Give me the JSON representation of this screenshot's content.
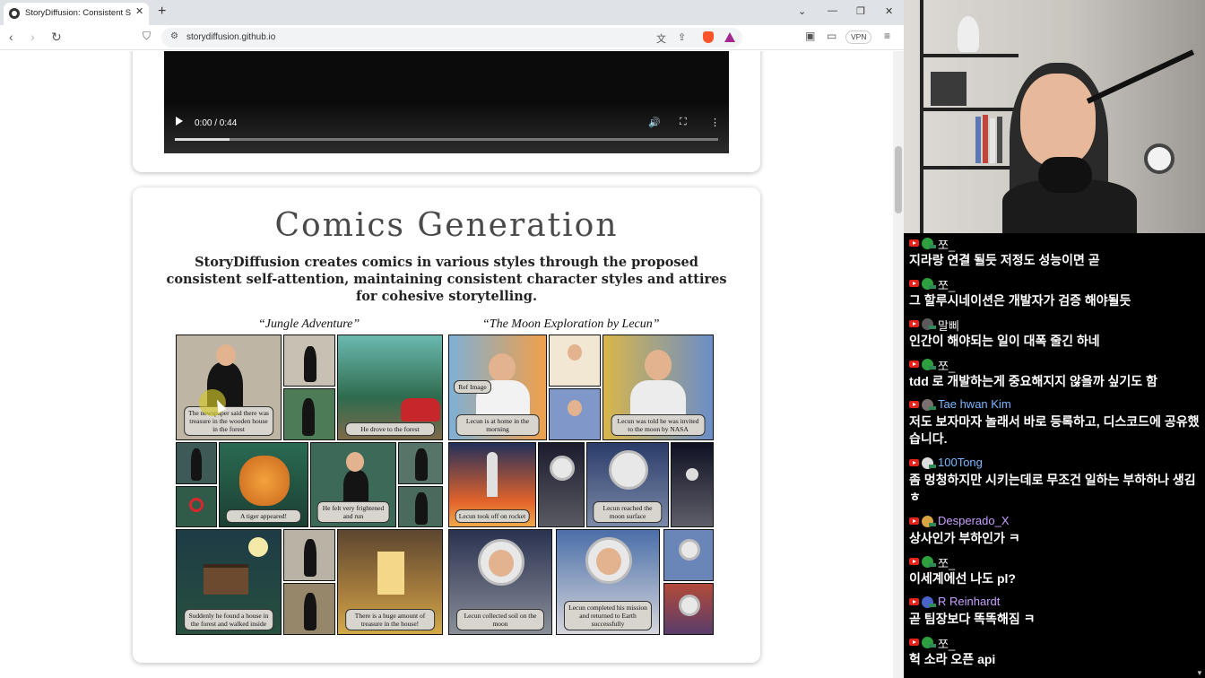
{
  "browser": {
    "tab_title": "StoryDiffusion: Consistent Self-",
    "url": "storydiffusion.github.io",
    "vpn_label": "VPN",
    "icons": [
      "globe-icon",
      "close-icon",
      "plus-icon",
      "chevron-down-icon",
      "minimize-icon",
      "restore-icon",
      "back-icon",
      "forward-icon",
      "reload-icon",
      "bookmark-icon",
      "translate-icon",
      "share-icon",
      "brave-shield-icon",
      "brave-rewards-icon",
      "sidebar-icon",
      "wallet-icon",
      "menu-icon"
    ]
  },
  "video": {
    "time": "0:00 / 0:44",
    "buffered_fraction": 0.1
  },
  "comics": {
    "title": "Comics Generation",
    "description": "StoryDiffusion creates comics in various styles through the proposed consistent self-attention, maintaining consistent character styles and attires for cohesive storytelling.",
    "strip1": {
      "title": "“Jungle Adventure”",
      "captions": [
        "The newspaper said there was treasure in the wooden house in the forest",
        "He drove to the forest",
        "A tiger appeared!",
        "He felt very frightened and run",
        "Suddenly he found a house in the forest and walked inside",
        "There is a huge amount of treasure in the house!"
      ]
    },
    "strip2": {
      "title": "“The Moon Exploration by Lecun”",
      "captions": [
        "Ref Image",
        "Lecun is at home in the morning",
        "Lecun was told he was invited to the moon by NASA",
        "Lecun took off on rocket",
        "Lecun reached the moon surface",
        "Lecun collected soil on the moon",
        "Lecun completed his mission and returned to Earth successfully"
      ]
    }
  },
  "chat": {
    "messages": [
      {
        "user": "쪼_",
        "text": "지라랑 연결 될듯 저정도 성능이면 곧",
        "name_color": "#f2f2f2",
        "avatar_color": "#2e9e3e"
      },
      {
        "user": "쪼_",
        "text": "그 할루시네이션은 개발자가 검증 해야될듯",
        "name_color": "#f2f2f2",
        "avatar_color": "#2e9e3e"
      },
      {
        "user": "말삐",
        "text": "인간이 해야되는 일이 대폭 줄긴 하네",
        "name_color": "#f2f2f2",
        "avatar_color": "#5a5a5a"
      },
      {
        "user": "쪼_",
        "text": "tdd 로 개발하는게 중요해지지 않을까 싶기도 함",
        "name_color": "#f2f2f2",
        "avatar_color": "#2e9e3e"
      },
      {
        "user": "Tae hwan Kim",
        "text": "저도 보자마자 놀래서 바로 등록하고, 디스코드에 공유했습니다.",
        "name_color": "#7ab8ff",
        "avatar_color": "#7a6f6f"
      },
      {
        "user": "100Tong",
        "text": "좀 멍청하지만 시키는데로 무조건 일하는 부하하나 생김 ㅎ",
        "name_color": "#7ab8ff",
        "avatar_color": "#dddddd"
      },
      {
        "user": "Desperado_X",
        "text": "상사인가 부하인가 ㅋ",
        "name_color": "#c7a0ff",
        "avatar_color": "#d9a441"
      },
      {
        "user": "쪼_",
        "text": "이세계에선 나도 pl?",
        "name_color": "#f2f2f2",
        "avatar_color": "#2e9e3e"
      },
      {
        "user": "R Reinhardt",
        "text": "곧 팀장보다 똑똑해짐 ㅋ",
        "name_color": "#c7a0ff",
        "avatar_color": "#4a63c8"
      },
      {
        "user": "쪼_",
        "text": "헉 소라 오픈 api",
        "name_color": "#f2f2f2",
        "avatar_color": "#2e9e3e"
      }
    ]
  }
}
